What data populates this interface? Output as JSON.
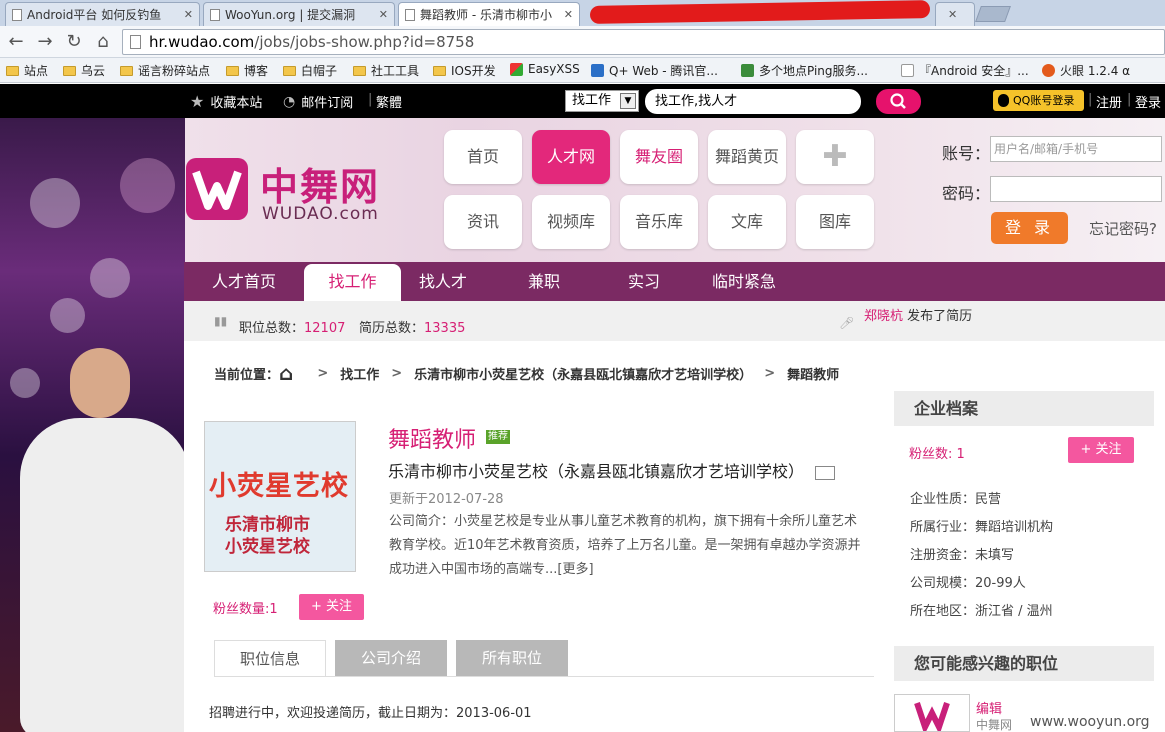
{
  "browser": {
    "tabs": [
      {
        "title": "Android平台 如何反钓鱼"
      },
      {
        "title": "WooYun.org | 提交漏洞"
      },
      {
        "title": "舞蹈教师 - 乐清市柳市小"
      }
    ],
    "url_host": "hr.wudao.com",
    "url_path": "/jobs/jobs-show.php?id=8758",
    "bookmarks": [
      "站点",
      "乌云",
      "谣言粉碎站点",
      "博客",
      "白帽子",
      "社工工具",
      "IOS开发",
      "EasyXSS",
      "Q+ Web - 腾讯官...",
      "多个地点Ping服务...",
      "『Android 安全』...",
      "火眼 1.2.4 α"
    ]
  },
  "sitetop": {
    "favorite": "收藏本站",
    "subscribe": "邮件订阅",
    "traditional": "繁體",
    "search_type": "找工作",
    "search_value": "找工作,找人才",
    "qq_login": "QQ账号登录",
    "register": "注册",
    "login": "登录"
  },
  "header": {
    "logo_cn": "中舞网",
    "logo_en": "WUDAO.com",
    "nav_row1": [
      "首页",
      "人才网",
      "舞友圈",
      "舞蹈黄页"
    ],
    "nav_row2": [
      "资讯",
      "视频库",
      "音乐库",
      "文库",
      "图库"
    ],
    "account_label": "账号：",
    "account_placeholder": "用户名/邮箱/手机号",
    "password_label": "密码：",
    "login_button": "登 录",
    "forgot": "忘记密码?"
  },
  "mainnav": [
    "人才首页",
    "找工作",
    "找人才",
    "兼职",
    "实习",
    "临时紧急"
  ],
  "stats": {
    "jobs_label": "职位总数：",
    "jobs_value": "12107",
    "resumes_label": "简历总数：",
    "resumes_value": "13335",
    "news_name": "郑晓杭",
    "news_text": " 发布了简历"
  },
  "breadcrumb": {
    "label": "当前位置：",
    "items": [
      "找工作",
      "乐清市柳市小荧星艺校（永嘉县瓯北镇嘉欣才艺培训学校）",
      "舞蹈教师"
    ]
  },
  "job": {
    "logo_line1": "小荧星艺校",
    "logo_line2": "乐清市柳市",
    "logo_line3": "小荧星艺校",
    "title": "舞蹈教师",
    "badge": "推荐",
    "company": "乐清市柳市小荧星艺校（永嘉县瓯北镇嘉欣才艺培训学校）",
    "updated": "更新于2012-07-28",
    "intro": "公司简介：小荧星艺校是专业从事儿童艺术教育的机构，旗下拥有十余所儿童艺术教育学校。近10年艺术教育资质，培养了上万名儿童。是一架拥有卓越办学资源并成功进入中国市场的高端专...[更多]",
    "fans_label": "粉丝数量:1",
    "follow": "+ 关注",
    "tabs": [
      "职位信息",
      "公司介绍",
      "所有职位"
    ],
    "recruit_text": "招聘进行中，欢迎投递简历，截止日期为：2013-06-01"
  },
  "sidebar": {
    "profile_title": "企业档案",
    "fans": "粉丝数: 1",
    "follow": "+ 关注",
    "rows": [
      "企业性质：民营",
      "所属行业：舞蹈培训机构",
      "注册资金：未填写",
      "公司规模：20-99人",
      "所在地区：浙江省 / 温州"
    ],
    "interest_title": "您可能感兴趣的职位",
    "interest_item": "编辑",
    "interest_sub": "中舞网"
  },
  "watermark": "www.wooyun.org",
  "colors": {
    "brand": "#d61f74",
    "nav": "#7b2a63",
    "accent_orange": "#f07a2a"
  }
}
